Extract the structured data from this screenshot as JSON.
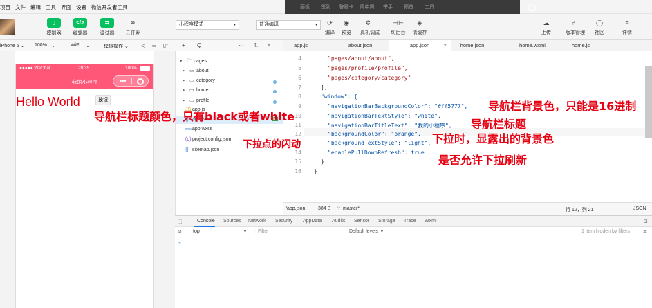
{
  "menu": {
    "items": [
      "项目",
      "文件",
      "编辑",
      "工具",
      "界面",
      "设置",
      "微信开发者工具"
    ]
  },
  "cloud_tabs": [
    "面板",
    "签到",
    "答题卡",
    "周中周",
    "举手",
    "预览",
    "工具"
  ],
  "toolbar": {
    "simulator": "模拟器",
    "editor": "编辑器",
    "debugger": "调试器",
    "cloud": "云开发",
    "mode": "小程序模式",
    "compile_mode": "普通编译",
    "compile": "编译",
    "preview": "预览",
    "remote_debug": "真机调试",
    "background": "切后台",
    "clear_cache": "清缓存",
    "upload": "上传",
    "version": "版本管理",
    "community": "社区",
    "details": "详情"
  },
  "simbar": {
    "device": "iPhone 5 ⌄",
    "zoom": "100%",
    "network": "WiFi",
    "operation": "模拟操作 ⌄"
  },
  "simulator": {
    "carrier": "●●●●● WeChat",
    "time": "20:35",
    "battery": "100%",
    "nav_title": "我的小程序",
    "hello": "Hello World",
    "button": "按钮"
  },
  "explorer": {
    "add": "+",
    "search": "Q",
    "more": "···",
    "items": [
      {
        "label": "pages",
        "type": "folder-open"
      },
      {
        "label": "about",
        "type": "folder"
      },
      {
        "label": "category",
        "type": "folder"
      },
      {
        "label": "home",
        "type": "folder"
      },
      {
        "label": "profile",
        "type": "folder"
      },
      {
        "label": "app.js",
        "type": "js"
      },
      {
        "label": "app.json",
        "type": "json"
      },
      {
        "label": "app.wxss",
        "type": "wxss"
      },
      {
        "label": "project.config.json",
        "type": "config"
      },
      {
        "label": "sitemap.json",
        "type": "json"
      }
    ],
    "modified_badge": "M"
  },
  "tabs": [
    {
      "label": "app.js"
    },
    {
      "label": "about.json"
    },
    {
      "label": "app.json",
      "active": true
    },
    {
      "label": "home.json"
    },
    {
      "label": "home.wxml"
    },
    {
      "label": "home.js"
    }
  ],
  "code": {
    "line_numbers": [
      "4",
      "5",
      "6",
      "7",
      "8",
      "9",
      "10",
      "11",
      "12",
      "13",
      "14",
      "15",
      "16"
    ],
    "lines": [
      "\"pages/about/about\",",
      "\"pages/profile/profile\",",
      "\"pages/category/category\"",
      "],",
      "\"window\": {",
      "\"navigationBarBackgroundColor\": \"#ff5777\",",
      "\"navigationBarTextStyle\": \"white\",",
      "\"navigationBarTitleText\": \"我的小程序\",",
      "\"backgroundColor\": \"orange\",",
      "\"backgroundTextStyle\": \"light\",",
      "\"enablePullDownRefresh\": true",
      "}",
      "}"
    ]
  },
  "editor_status": {
    "path": "/app.json",
    "size": "384 B",
    "branch": "master*",
    "position": "行 12，列 21",
    "lang": "JSON"
  },
  "devtools": {
    "tabs": [
      "Console",
      "Sources",
      "Network",
      "Security",
      "AppData",
      "Audits",
      "Sensor",
      "Storage",
      "Trace",
      "Wxml"
    ],
    "context": "top",
    "filter_placeholder": "Filter",
    "levels": "Default levels ▼",
    "hidden": "1 item hidden by filters",
    "prompt": ">"
  },
  "annotations": {
    "text_style": "导航栏标题颜色，只有black或者white",
    "bg_color": "导航栏背景色，只能是16进制",
    "title": "导航栏标题",
    "pull_bg": "下拉时，显露出的背景色",
    "pull_dots": "下拉点的闪动",
    "enable_pull": "是否允许下拉刷新"
  },
  "colors": {
    "nav_bar": "#ff5777",
    "annotation": "#e60012",
    "accent_green": "#07c160"
  }
}
